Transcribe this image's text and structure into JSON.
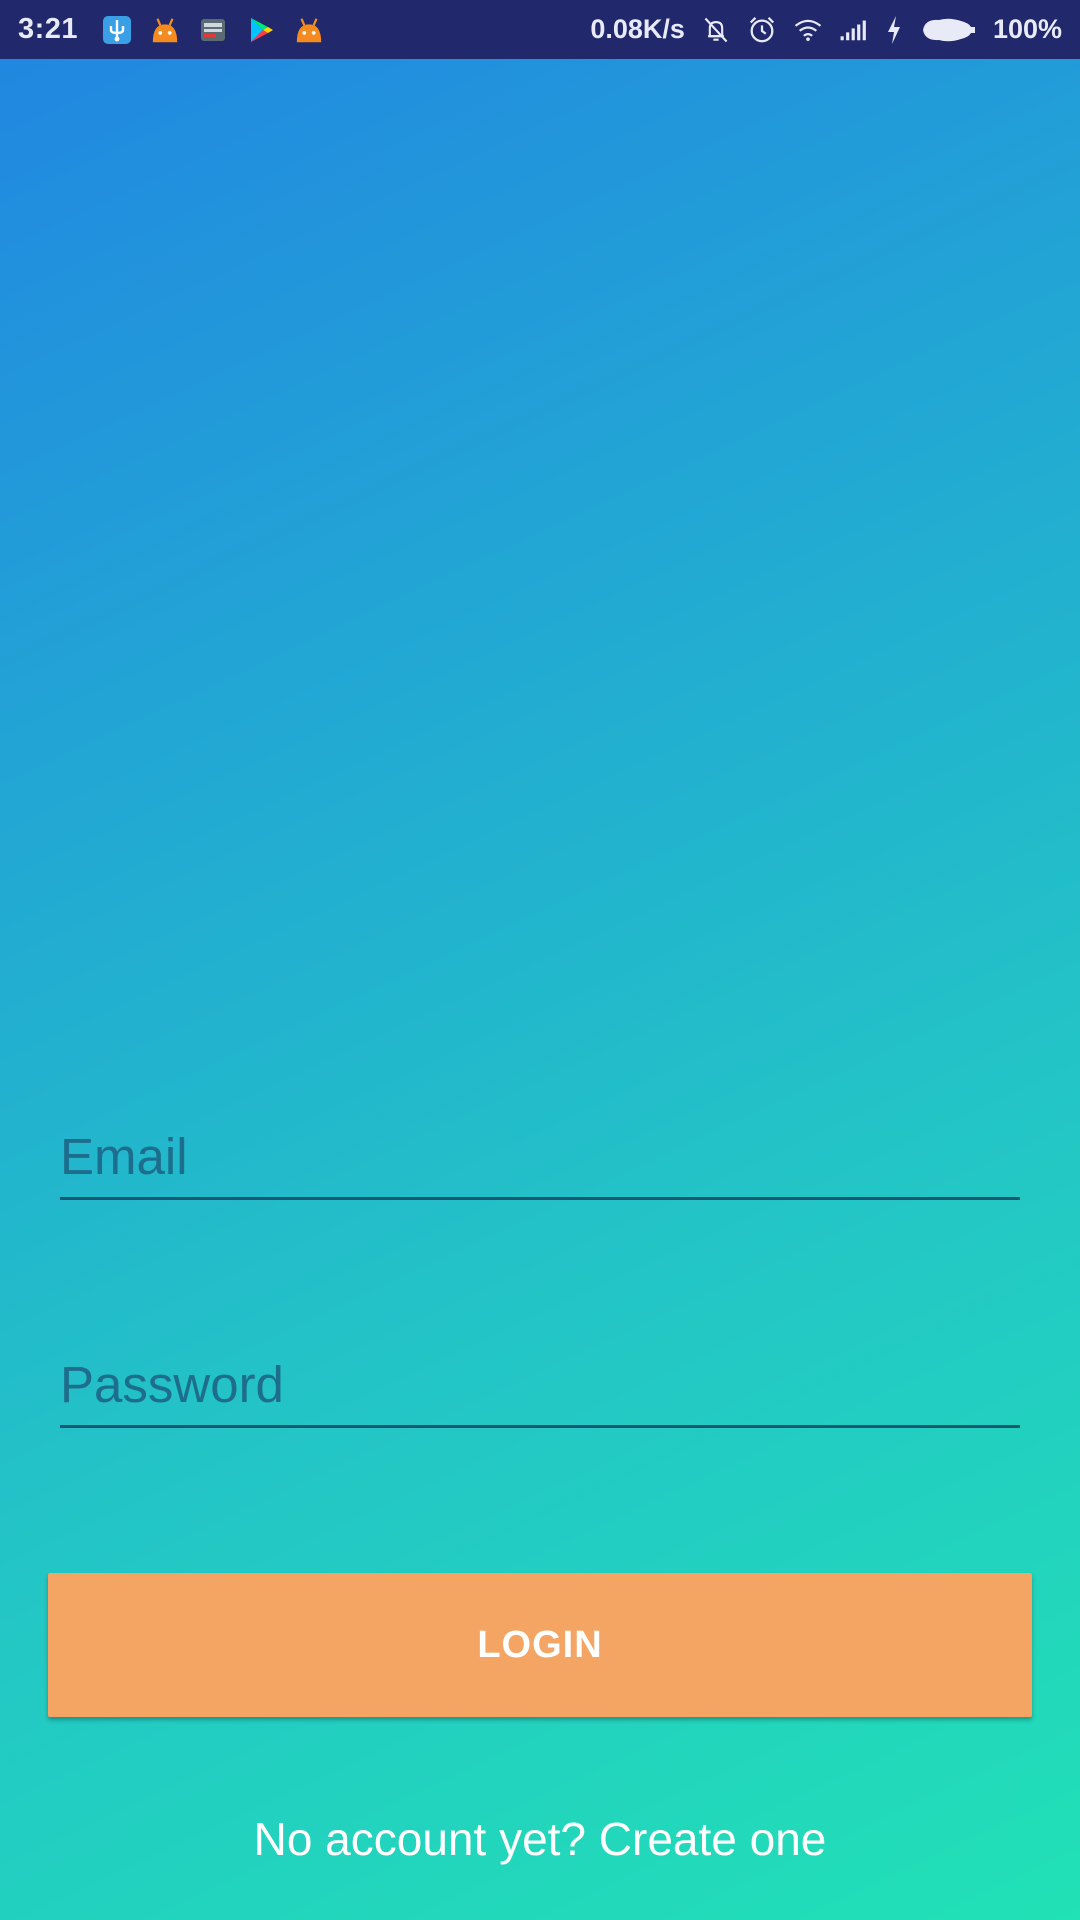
{
  "status_bar": {
    "time": "3:21",
    "network_speed": "0.08K/s",
    "battery_percent": "100%",
    "app_icons": [
      "usb-icon",
      "android-icon",
      "news-app-icon",
      "play-store-icon",
      "android-icon"
    ],
    "system_icons": [
      "mute-icon",
      "alarm-icon",
      "wifi-icon",
      "signal-icon",
      "charging-icon",
      "battery-icon"
    ],
    "background_color": "#21286b"
  },
  "login_form": {
    "email_placeholder": "Email",
    "password_placeholder": "Password",
    "login_label": "LOGIN",
    "create_account_text": "No account yet? Create one"
  },
  "colors": {
    "gradient_start": "#2185e2",
    "gradient_end": "#21e1b6",
    "button": "#f4a463",
    "field_underline": "#1a5770"
  }
}
